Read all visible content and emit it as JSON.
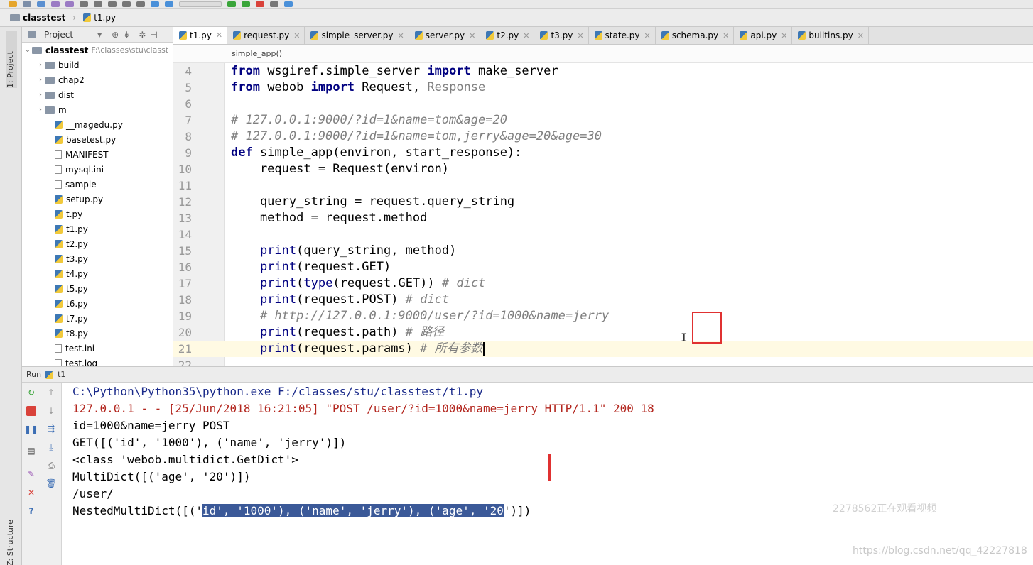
{
  "breadcrumb": {
    "project": "classtest",
    "file": "t1.py"
  },
  "left_strip": {
    "project_tab": "1: Project",
    "structure_tab": "Z: Structure"
  },
  "project_panel": {
    "title": "Project",
    "root_name": "classtest",
    "root_path": "F:\\classes\\stu\\classt",
    "folders": [
      "build",
      "chap2",
      "dist",
      "m"
    ],
    "files": [
      {
        "name": "__magedu.py",
        "type": "py"
      },
      {
        "name": "basetest.py",
        "type": "py"
      },
      {
        "name": "MANIFEST",
        "type": "file"
      },
      {
        "name": "mysql.ini",
        "type": "file"
      },
      {
        "name": "sample",
        "type": "file"
      },
      {
        "name": "setup.py",
        "type": "py"
      },
      {
        "name": "t.py",
        "type": "py"
      },
      {
        "name": "t1.py",
        "type": "py"
      },
      {
        "name": "t2.py",
        "type": "py"
      },
      {
        "name": "t3.py",
        "type": "py"
      },
      {
        "name": "t4.py",
        "type": "py"
      },
      {
        "name": "t5.py",
        "type": "py"
      },
      {
        "name": "t6.py",
        "type": "py"
      },
      {
        "name": "t7.py",
        "type": "py"
      },
      {
        "name": "t8.py",
        "type": "py"
      },
      {
        "name": "test.ini",
        "type": "file"
      },
      {
        "name": "test.log",
        "type": "file"
      }
    ]
  },
  "editor_tabs": [
    {
      "label": "t1.py",
      "active": true
    },
    {
      "label": "request.py",
      "active": false
    },
    {
      "label": "simple_server.py",
      "active": false
    },
    {
      "label": "server.py",
      "active": false
    },
    {
      "label": "t2.py",
      "active": false
    },
    {
      "label": "t3.py",
      "active": false
    },
    {
      "label": "state.py",
      "active": false
    },
    {
      "label": "schema.py",
      "active": false
    },
    {
      "label": "api.py",
      "active": false
    },
    {
      "label": "builtins.py",
      "active": false
    }
  ],
  "editor": {
    "function_crumb": "simple_app()",
    "lines": [
      {
        "n": "4",
        "parts": [
          [
            "kw",
            "from"
          ],
          [
            "t",
            " wsgiref.simple_server "
          ],
          [
            "kw",
            "import"
          ],
          [
            "t",
            " make_server"
          ]
        ]
      },
      {
        "n": "5",
        "parts": [
          [
            "kw",
            "from"
          ],
          [
            "t",
            " webob "
          ],
          [
            "kw",
            "import"
          ],
          [
            "t",
            " Request, "
          ],
          [
            "dim",
            "Response"
          ]
        ]
      },
      {
        "n": "6",
        "parts": []
      },
      {
        "n": "7",
        "parts": [
          [
            "cm",
            "# 127.0.0.1:9000/?id=1&name=tom&age=20"
          ]
        ]
      },
      {
        "n": "8",
        "parts": [
          [
            "cm",
            "# 127.0.0.1:9000/?id=1&name=tom,jerry&age=20&age=30"
          ]
        ]
      },
      {
        "n": "9",
        "parts": [
          [
            "kw",
            "def"
          ],
          [
            "t",
            " simple_app(environ, start_response):"
          ]
        ]
      },
      {
        "n": "10",
        "parts": [
          [
            "t",
            "    request = Request(environ)"
          ]
        ]
      },
      {
        "n": "11",
        "parts": []
      },
      {
        "n": "12",
        "parts": [
          [
            "t",
            "    query_string = request.query_string"
          ]
        ]
      },
      {
        "n": "13",
        "parts": [
          [
            "t",
            "    method = request.method"
          ]
        ]
      },
      {
        "n": "14",
        "parts": []
      },
      {
        "n": "15",
        "parts": [
          [
            "t",
            "    "
          ],
          [
            "bi",
            "print"
          ],
          [
            "t",
            "(query_string, method)"
          ]
        ]
      },
      {
        "n": "16",
        "parts": [
          [
            "t",
            "    "
          ],
          [
            "bi",
            "print"
          ],
          [
            "t",
            "(request.GET)"
          ]
        ]
      },
      {
        "n": "17",
        "parts": [
          [
            "t",
            "    "
          ],
          [
            "bi",
            "print"
          ],
          [
            "t",
            "("
          ],
          [
            "bi",
            "type"
          ],
          [
            "t",
            "(request.GET)) "
          ],
          [
            "cm",
            "# dict"
          ]
        ]
      },
      {
        "n": "18",
        "parts": [
          [
            "t",
            "    "
          ],
          [
            "bi",
            "print"
          ],
          [
            "t",
            "(request.POST) "
          ],
          [
            "cm",
            "# dict"
          ]
        ]
      },
      {
        "n": "19",
        "parts": [
          [
            "t",
            "    "
          ],
          [
            "cm",
            "# http://127.0.0.1:9000/user/?id=1000&name=jerry"
          ]
        ]
      },
      {
        "n": "20",
        "parts": [
          [
            "t",
            "    "
          ],
          [
            "bi",
            "print"
          ],
          [
            "t",
            "(request.path) "
          ],
          [
            "cm",
            "# 路径"
          ]
        ]
      },
      {
        "n": "21",
        "parts": [
          [
            "t",
            "    "
          ],
          [
            "bi",
            "print"
          ],
          [
            "t",
            "(request.params) "
          ],
          [
            "cm",
            "# 所有参数"
          ]
        ],
        "current": true
      },
      {
        "n": "22",
        "parts": []
      }
    ]
  },
  "run_panel": {
    "label": "Run",
    "config": "t1"
  },
  "console": {
    "lines": [
      {
        "text": "C:\\Python\\Python35\\python.exe F:/classes/stu/classtest/t1.py",
        "style": "blue"
      },
      {
        "text": "127.0.0.1 - - [25/Jun/2018 16:21:05] \"POST /user/?id=1000&name=jerry HTTP/1.1\" 200 18",
        "style": "red"
      },
      {
        "text": "id=1000&name=jerry POST",
        "style": "normal"
      },
      {
        "text": "GET([('id', '1000'), ('name', 'jerry')])",
        "style": "normal"
      },
      {
        "text": "<class 'webob.multidict.GetDict'>",
        "style": "normal"
      },
      {
        "text": "MultiDict([('age', '20')])",
        "style": "normal"
      },
      {
        "text": "/user/",
        "style": "normal"
      }
    ],
    "last_line_pre": "NestedMultiDict([('",
    "last_line_sel": "id', '1000'), ('name', 'jerry'), ('age', '20",
    "last_line_post": "')])"
  },
  "watermarks": {
    "viewer": "2278562正在观看视频",
    "url": "https://blog.csdn.net/qq_42227818"
  },
  "colors": {
    "keyword": "#000080",
    "comment": "#808080",
    "console_red": "#b3261e",
    "selection": "#3b5998",
    "annotation_red": "#e03131"
  }
}
